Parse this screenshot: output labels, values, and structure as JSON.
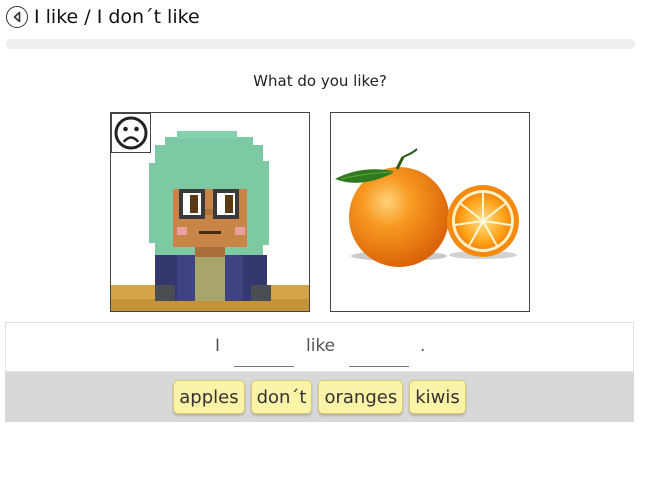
{
  "header": {
    "title": "I like / I don´t like",
    "back_icon": "back-arrow-icon"
  },
  "progress": {
    "value": 0
  },
  "question": "What do you like?",
  "cards": [
    {
      "kind": "avatar",
      "emotion_icon": "sad-face-icon"
    },
    {
      "kind": "fruit",
      "image": "oranges-picture"
    }
  ],
  "sentence": {
    "word1": "I",
    "word2": "like",
    "end": "."
  },
  "word_bank": [
    "apples",
    "don´t",
    "oranges",
    "kiwis"
  ],
  "colors": {
    "chip_bg": "#fbf3a7",
    "bank_bg": "#d8d8d8",
    "avatar_hair": "#7cc9a4",
    "orange": "#f0830e"
  }
}
